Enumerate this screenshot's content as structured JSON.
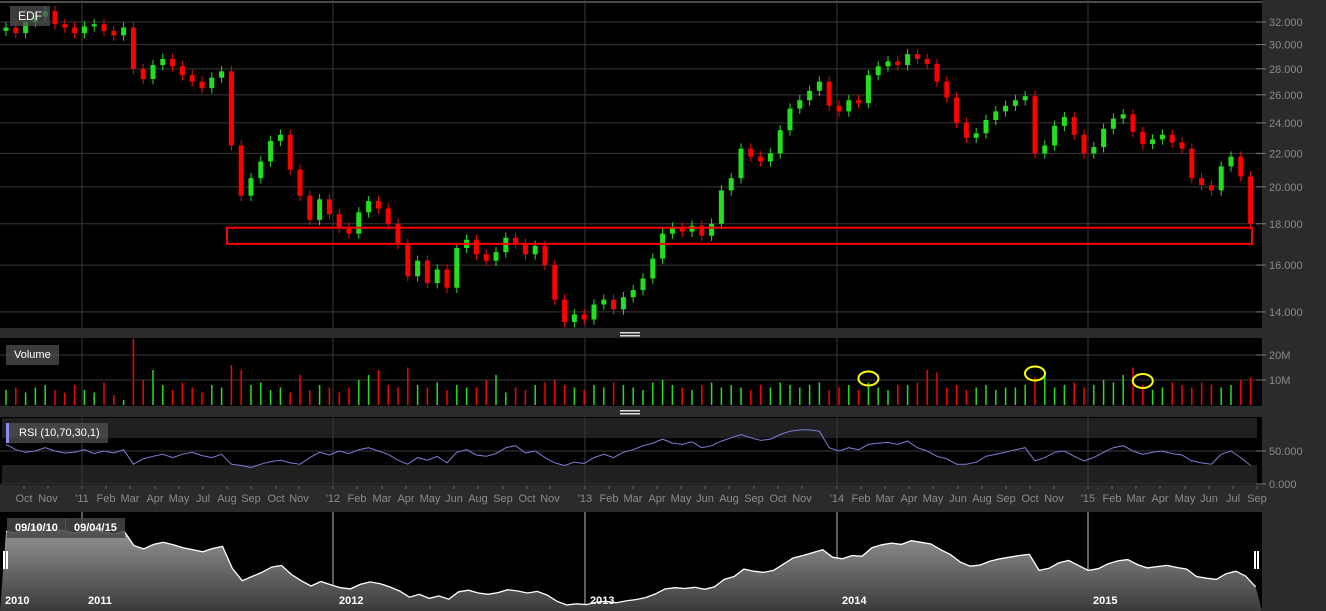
{
  "symbol": "EDF",
  "volume_label": "Volume",
  "rsi_label": "RSI (10,70,30,1)",
  "range": {
    "start": "09/10/10",
    "end": "09/04/15"
  },
  "colors": {
    "up": "#22e01e",
    "down": "#ff0000",
    "rsi": "#7b7fd8",
    "highlight": "#ffff00",
    "box": "#ff0000"
  },
  "chart_data": {
    "type": "candlestick",
    "price_axis": {
      "ticks": [
        14,
        16,
        18,
        20,
        22,
        24,
        26,
        28,
        30,
        32
      ],
      "tick_labels": [
        "14.000",
        "16.000",
        "18.000",
        "20.000",
        "22.000",
        "24.000",
        "26.000",
        "28.000",
        "30.000",
        "32.000"
      ],
      "scale": "log"
    },
    "volume_axis": {
      "ticks": [
        10,
        20
      ],
      "tick_labels": [
        "10M",
        "20M"
      ]
    },
    "rsi_axis": {
      "ticks": [
        0,
        50
      ],
      "tick_labels": [
        "0.000",
        "50.000"
      ],
      "overbought": 70,
      "oversold": 30
    },
    "support_zone": [
      17.0,
      17.8
    ],
    "highlighted_volume_indices": [
      88,
      105,
      116
    ],
    "months": [
      "Oct",
      "Nov",
      "'11",
      "Feb",
      "Mar",
      "Apr",
      "May",
      "Jul",
      "Aug",
      "Sep",
      "Oct",
      "Nov",
      "'12",
      "Feb",
      "Mar",
      "Apr",
      "May",
      "Jun",
      "Aug",
      "Sep",
      "Oct",
      "Nov",
      "'13",
      "Feb",
      "Mar",
      "Apr",
      "May",
      "Jun",
      "Aug",
      "Sep",
      "Oct",
      "Nov",
      "'14",
      "Feb",
      "Mar",
      "Apr",
      "May",
      "Jun",
      "Aug",
      "Sep",
      "Oct",
      "Nov",
      "'15",
      "Feb",
      "Mar",
      "Apr",
      "May",
      "Jun",
      "Jul",
      "Sep"
    ],
    "years": [
      "2010",
      "2011",
      "2012",
      "2013",
      "2014",
      "2015"
    ],
    "closes": [
      31.5,
      31.0,
      32.0,
      32.5,
      33.0,
      31.8,
      31.5,
      31.0,
      31.6,
      31.8,
      31.2,
      30.8,
      31.5,
      28.0,
      27.2,
      28.3,
      28.8,
      28.2,
      27.5,
      27.0,
      26.5,
      27.3,
      27.8,
      22.5,
      19.5,
      20.5,
      21.5,
      22.8,
      23.2,
      21.0,
      19.5,
      18.2,
      19.3,
      18.5,
      17.8,
      17.5,
      18.6,
      19.2,
      18.8,
      18.0,
      17.0,
      15.5,
      16.2,
      15.2,
      15.8,
      15.0,
      16.8,
      17.2,
      16.5,
      16.2,
      16.6,
      17.3,
      17.0,
      16.5,
      16.9,
      16.0,
      14.5,
      13.6,
      13.9,
      13.7,
      14.3,
      14.5,
      14.1,
      14.6,
      14.9,
      15.4,
      16.3,
      17.5,
      17.8,
      17.6,
      17.9,
      17.4,
      18.0,
      19.8,
      20.5,
      22.3,
      21.8,
      21.5,
      22.0,
      23.5,
      25.0,
      25.6,
      26.3,
      27.0,
      25.2,
      24.8,
      25.6,
      25.4,
      27.5,
      28.2,
      28.6,
      28.3,
      29.2,
      28.8,
      28.4,
      27.0,
      25.8,
      24.0,
      23.0,
      23.3,
      24.2,
      24.8,
      25.2,
      25.6,
      25.9,
      22.0,
      22.5,
      23.8,
      24.4,
      23.2,
      22.0,
      22.4,
      23.6,
      24.3,
      24.6,
      23.4,
      22.6,
      22.9,
      23.2,
      22.7,
      22.3,
      20.5,
      20.1,
      19.8,
      21.2,
      21.8,
      20.6,
      18.0
    ],
    "volumes_millions": [
      6,
      7,
      5,
      7,
      8,
      6,
      5,
      8,
      6,
      5,
      9,
      4,
      2,
      28,
      10,
      14,
      8,
      6,
      9,
      7,
      5,
      8,
      7,
      16,
      14,
      8,
      9,
      6,
      7,
      5,
      12,
      6,
      8,
      7,
      5,
      7,
      10,
      12,
      14,
      8,
      7,
      15,
      8,
      7,
      9,
      6,
      8,
      7,
      7,
      10,
      12,
      5,
      7,
      6,
      8,
      9,
      10,
      8,
      7,
      6,
      8,
      7,
      9,
      8,
      7,
      6,
      9,
      10,
      8,
      7,
      6,
      8,
      9,
      7,
      8,
      7,
      6,
      8,
      7,
      9,
      8,
      7,
      8,
      9,
      6,
      7,
      8,
      6,
      9,
      7,
      6,
      8,
      8,
      9,
      14,
      13,
      7,
      8,
      6,
      7,
      8,
      6,
      7,
      7,
      8,
      11,
      13,
      7,
      8,
      9,
      7,
      8,
      10,
      9,
      12,
      15,
      8,
      6,
      7,
      9,
      8,
      7,
      9,
      8,
      7,
      8,
      10,
      11
    ],
    "rsi": [
      60,
      52,
      48,
      50,
      55,
      50,
      47,
      48,
      52,
      46,
      50,
      47,
      52,
      30,
      38,
      42,
      45,
      40,
      45,
      48,
      43,
      40,
      45,
      30,
      28,
      25,
      30,
      34,
      36,
      32,
      30,
      40,
      48,
      44,
      50,
      46,
      52,
      55,
      50,
      45,
      36,
      30,
      40,
      36,
      42,
      32,
      48,
      52,
      44,
      42,
      46,
      55,
      58,
      47,
      50,
      40,
      32,
      28,
      33,
      31,
      40,
      45,
      40,
      48,
      52,
      58,
      62,
      68,
      62,
      60,
      64,
      55,
      58,
      65,
      70,
      75,
      70,
      66,
      68,
      75,
      80,
      82,
      82,
      80,
      55,
      50,
      55,
      52,
      60,
      62,
      63,
      60,
      65,
      55,
      50,
      42,
      38,
      30,
      30,
      33,
      42,
      45,
      48,
      52,
      55,
      35,
      40,
      48,
      50,
      42,
      35,
      40,
      48,
      55,
      58,
      50,
      45,
      48,
      50,
      46,
      44,
      35,
      32,
      30,
      45,
      50,
      40,
      28
    ]
  }
}
